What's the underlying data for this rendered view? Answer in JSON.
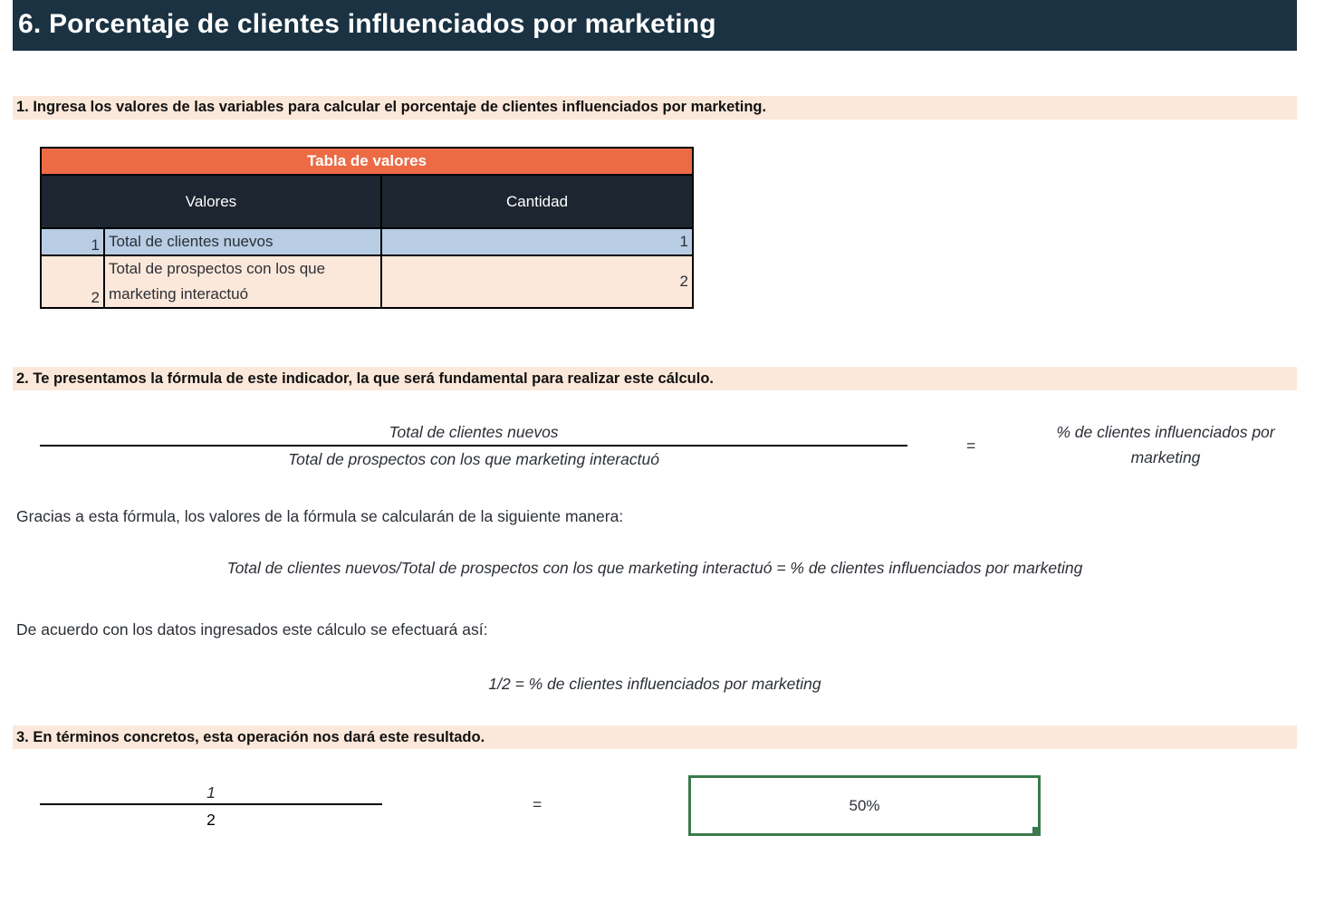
{
  "title": "6. Porcentaje de clientes influenciados por marketing",
  "sections": {
    "s1": "1. Ingresa los valores de las variables para calcular el porcentaje de clientes influenciados por marketing.",
    "s2": "2. Te presentamos la fórmula de este indicador, la que será fundamental para realizar este cálculo.",
    "s3": "3. En términos concretos, esta operación nos dará este resultado."
  },
  "table": {
    "caption": "Tabla de valores",
    "headers": [
      "Valores",
      "Cantidad"
    ],
    "rows": [
      {
        "index": "1",
        "label": "Total de clientes nuevos",
        "value": "1"
      },
      {
        "index": "2",
        "label_line1": "Total de prospectos con los que",
        "label_line2": "marketing interactuó",
        "value": "2"
      }
    ]
  },
  "formula": {
    "numerator": "Total de clientes nuevos",
    "denominator": "Total de prospectos con los que marketing interactuó",
    "equals": "=",
    "result_line1": "% de clientes influenciados por",
    "result_line2": "marketing"
  },
  "explanation": {
    "intro": "Gracias a esta fórmula, los valores de la fórmula se calcularán de la siguiente manera:",
    "formula_inline": "Total de clientes nuevos/Total de prospectos con los que marketing interactuó = % de clientes influenciados por marketing",
    "data_intro": "De acuerdo con los datos ingresados este cálculo se efectuará así:",
    "data_formula": "1/2 = % de clientes influenciados por marketing"
  },
  "result": {
    "numerator": "1",
    "denominator": "2",
    "equals": "=",
    "value": "50%"
  }
}
